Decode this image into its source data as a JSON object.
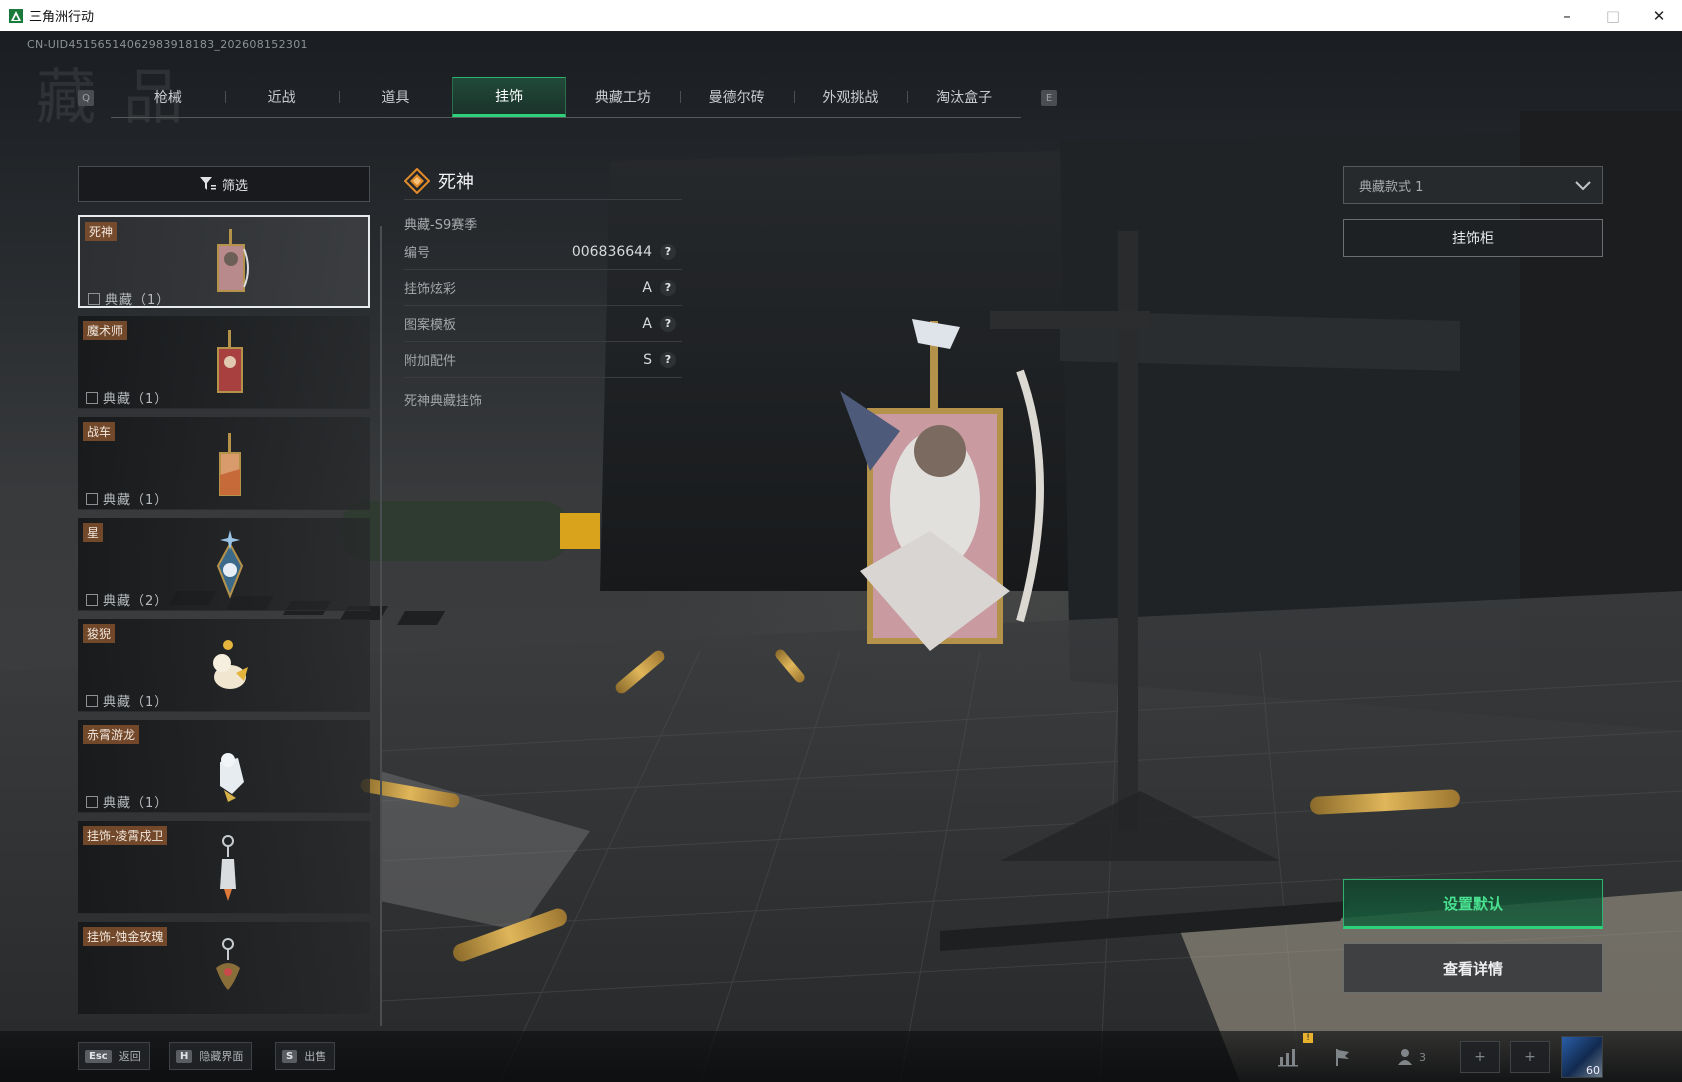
{
  "window": {
    "title": "三角洲行动",
    "minimize": "–",
    "maximize": "□",
    "close": "✕"
  },
  "uid_text": "CN-UID451565140629839181​83_202608152301",
  "tabs": {
    "prev_key": "Q",
    "next_key": "E",
    "items": [
      {
        "label": "枪械"
      },
      {
        "label": "近战"
      },
      {
        "label": "道具"
      },
      {
        "label": "挂饰",
        "active": true
      },
      {
        "label": "典藏工坊"
      },
      {
        "label": "曼德尔砖"
      },
      {
        "label": "外观挑战"
      },
      {
        "label": "淘汰盒子"
      }
    ]
  },
  "filter_label": "筛选",
  "items": [
    {
      "name": "死神",
      "rarity": "典藏（1）",
      "selected": true
    },
    {
      "name": "魔术师",
      "rarity": "典藏（1）"
    },
    {
      "name": "战车",
      "rarity": "典藏（1）"
    },
    {
      "name": "星",
      "rarity": "典藏（2）"
    },
    {
      "name": "狻猊",
      "rarity": "典藏（1）"
    },
    {
      "name": "赤霄游龙",
      "rarity": "典藏（1）"
    },
    {
      "name": "挂饰-凌霄戍卫",
      "rarity": ""
    },
    {
      "name": "挂饰-蚀金玫瑰",
      "rarity": ""
    }
  ],
  "detail": {
    "title": "死神",
    "season": "典藏-S9赛季",
    "rows": [
      {
        "label": "编号",
        "value": "006836644"
      },
      {
        "label": "挂饰炫彩",
        "value": "A"
      },
      {
        "label": "图案模板",
        "value": "A"
      },
      {
        "label": "附加配件",
        "value": "S"
      }
    ],
    "help_glyph": "?",
    "footer": "死神典藏挂饰"
  },
  "style_select": {
    "value": "典藏款式 1"
  },
  "buttons": {
    "case": "挂饰柜",
    "set_default": "设置默认",
    "view_details": "查看详情"
  },
  "bottom_hints": [
    {
      "key": "Esc",
      "label": "返回"
    },
    {
      "key": "H",
      "label": "隐藏界面"
    },
    {
      "key": "S",
      "label": "出售"
    }
  ],
  "bottom_right": {
    "squad_count": "3",
    "level": "60",
    "plus_glyph": "+",
    "warning_glyph": "!"
  },
  "colors": {
    "accent_green": "#2ed27b",
    "tag_brown": "#82502d",
    "diamond_orange": "#e08a2a"
  },
  "icons": [
    "filter-icon",
    "diamond-icon",
    "chevron-down-icon",
    "stats-icon",
    "flag-icon",
    "squad-icon",
    "plus-icon",
    "avatar"
  ]
}
